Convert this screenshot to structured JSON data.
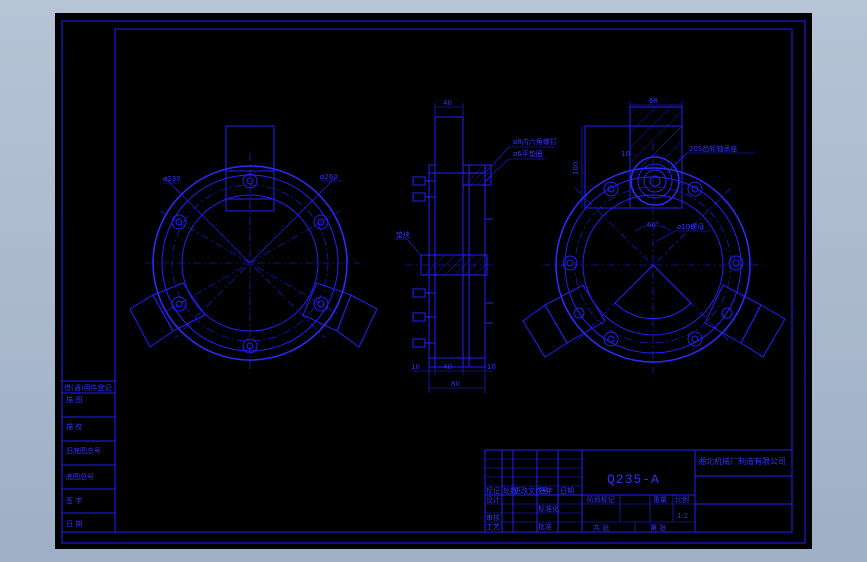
{
  "drawing": {
    "material": "Q235-A",
    "company": "湘北机械厂制造有限公司",
    "scale": "1:2",
    "dimensions": {
      "top_width_side": "40",
      "bottom_left_side": "10",
      "bottom_mid_side": "40",
      "bottom_right_side": "10",
      "bottom_total_side": "80",
      "top_width_right": "68",
      "left_height_right": "100",
      "small_dim_right": "10",
      "dia_left_1": "ø230",
      "dia_left_2": "ø260",
      "angle_right": "60°"
    },
    "notes": {
      "note_side_1": "ø8内六角螺钉",
      "note_side_2": "ø6平垫圈",
      "note_side_3": "垫块",
      "note_right_1": "20S齿轮轴承座",
      "note_right_2": "ø10螺母"
    },
    "side_table": [
      "借(通)用件登记",
      "描    图",
      "描    校",
      "旧底图总号",
      "底图总号",
      "签    字",
      "日    期"
    ],
    "title_block": {
      "labels": [
        "标记",
        "处数",
        "更改文件号",
        "签字",
        "日期"
      ],
      "row_labels": [
        "设计",
        "审核",
        "工艺"
      ],
      "extra_labels": [
        "标准化",
        "批准"
      ],
      "stage_label": "阶段标记",
      "weight_label": "重量",
      "scale_label": "比例",
      "sheet_label": "共  张",
      "sheet_num_label": "第  张"
    }
  }
}
